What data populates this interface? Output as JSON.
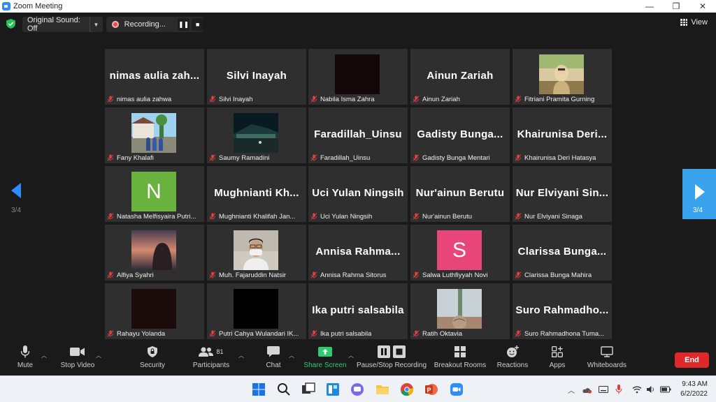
{
  "window": {
    "title": "Zoom Meeting",
    "minimize": "—",
    "maximize": "❐",
    "close": "✕"
  },
  "topbar": {
    "original_sound": "Original Sound: Off",
    "recording": "Recording...",
    "pause_glyph": "❚❚",
    "stop_glyph": "■",
    "view": "View"
  },
  "navigation": {
    "left_page": "3/4",
    "right_page": "3/4"
  },
  "tiles": [
    {
      "big": "nimas aulia zah...",
      "name": "nimas aulia zahwa"
    },
    {
      "big": "Silvi Inayah",
      "name": "Silvi Inayah"
    },
    {
      "big": "",
      "name": "Nabila Isma Zahra"
    },
    {
      "big": "Ainun Zariah",
      "name": "Ainun Zariah"
    },
    {
      "big": "",
      "name": "Fitriani Pramita Gurning"
    },
    {
      "big": "",
      "name": "Fany Khalafi"
    },
    {
      "big": "",
      "name": "Saumy Ramadini"
    },
    {
      "big": "Faradillah_Uinsu",
      "name": "Faradillah_Uinsu"
    },
    {
      "big": "Gadisty Bunga...",
      "name": "Gadisty Bunga Mentari"
    },
    {
      "big": "Khairunisa Deri...",
      "name": "Khairunisa Deri Hatasya"
    },
    {
      "big": "",
      "name": "Natasha Melfisyaira Putri...",
      "avatar": "N"
    },
    {
      "big": "Mughnianti Kh...",
      "name": "Mughnianti Khalifah Jan..."
    },
    {
      "big": "Uci Yulan Ningsih",
      "name": "Uci Yulan Ningsih"
    },
    {
      "big": "Nur'ainun Berutu",
      "name": "Nur'ainun Berutu"
    },
    {
      "big": "Nur Elviyani Sin...",
      "name": "Nur Elviyani Sinaga"
    },
    {
      "big": "",
      "name": "Alfiya Syahri"
    },
    {
      "big": "",
      "name": "Muh. Fajaruddin Natsir"
    },
    {
      "big": "Annisa Rahma...",
      "name": "Annisa Rahma Sitorus"
    },
    {
      "big": "",
      "name": "Salwa Luthfiyyah Novi",
      "avatar": "S"
    },
    {
      "big": "Clarissa Bunga...",
      "name": "Clarissa Bunga Mahira"
    },
    {
      "big": "",
      "name": "Rahayu Yolanda"
    },
    {
      "big": "",
      "name": "Putri Cahya Wulandari IK..."
    },
    {
      "big": "Ika putri salsabila",
      "name": "Ika putri salsabila"
    },
    {
      "big": "",
      "name": "Ratih Oktavia"
    },
    {
      "big": "Suro Rahmadho...",
      "name": "Suro Rahmadhona Tuma..."
    }
  ],
  "toolbar": {
    "mute": "Mute",
    "stop_video": "Stop Video",
    "security": "Security",
    "participants": "Participants",
    "participants_count": "81",
    "chat": "Chat",
    "share_screen": "Share Screen",
    "pause_stop_recording": "Pause/Stop Recording",
    "breakout_rooms": "Breakout Rooms",
    "reactions": "Reactions",
    "apps": "Apps",
    "whiteboards": "Whiteboards",
    "end": "End"
  },
  "taskbar": {
    "time": "9:43 AM",
    "date": "6/2/2022"
  },
  "colors": {
    "accent": "#2d8cff",
    "share_green": "#2ecc71",
    "end_red": "#e02828",
    "tile_bg": "#2f2f2f",
    "avatar_n": "#6ab23e",
    "avatar_s": "#e8457a"
  }
}
